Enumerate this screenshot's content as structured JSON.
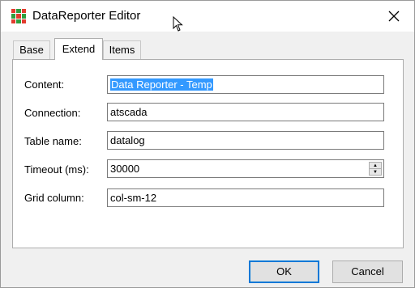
{
  "window": {
    "title": "DataReporter Editor"
  },
  "tabs": [
    {
      "label": "Base"
    },
    {
      "label": "Extend",
      "active": true
    },
    {
      "label": "Items"
    }
  ],
  "fields": {
    "content": {
      "label": "Content:",
      "value": "Data Reporter - Temp"
    },
    "connection": {
      "label": "Connection:",
      "value": "atscada"
    },
    "table_name": {
      "label": "Table name:",
      "value": "datalog"
    },
    "timeout": {
      "label": "Timeout (ms):",
      "value": "30000"
    },
    "grid_column": {
      "label": "Grid column:",
      "value": "col-sm-12"
    }
  },
  "buttons": {
    "ok": "OK",
    "cancel": "Cancel"
  },
  "icons": {
    "app": "grid-app-icon",
    "close": "close-icon",
    "cursor": "mouse-cursor-icon",
    "spin_up": "arrow-up-icon",
    "spin_down": "arrow-down-icon"
  },
  "colors": {
    "selection": "#3399ff",
    "default_button_border": "#0078d7",
    "icon_red": "#e23b2e",
    "icon_green": "#2e9e3e"
  }
}
